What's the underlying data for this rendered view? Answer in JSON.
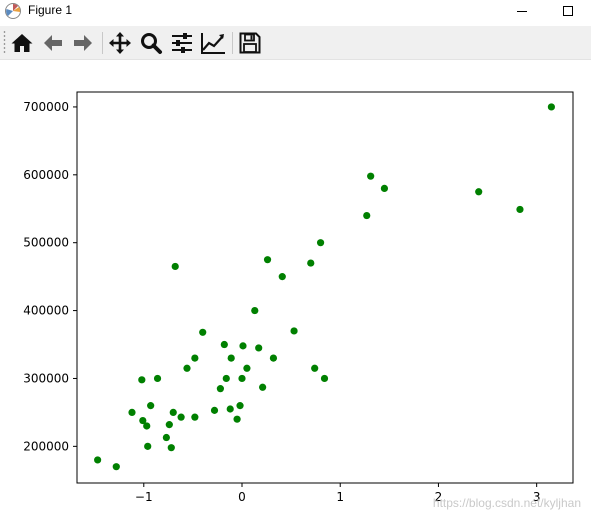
{
  "window": {
    "title": "Figure 1"
  },
  "toolbar": {
    "buttons": [
      "home-icon",
      "back-arrow-icon",
      "forward-arrow-icon",
      "pan-icon",
      "zoom-icon",
      "subplots-config-icon",
      "edit-axis-icon",
      "save-icon"
    ]
  },
  "watermark": "https://blog.csdn.net/kyljhan",
  "chart_data": {
    "type": "scatter",
    "title": "",
    "xlabel": "",
    "ylabel": "",
    "xlim": [
      -1.68,
      3.37
    ],
    "ylim": [
      146000,
      722000
    ],
    "xticks": [
      -1,
      0,
      1,
      2,
      3
    ],
    "xtick_labels": [
      "−1",
      "0",
      "1",
      "2",
      "3"
    ],
    "yticks": [
      200000,
      300000,
      400000,
      500000,
      600000,
      700000
    ],
    "ytick_labels": [
      "200000",
      "300000",
      "400000",
      "500000",
      "600000",
      "700000"
    ],
    "grid": false,
    "legend": "none",
    "color": "#008000",
    "series": [
      {
        "points": [
          [
            -1.47,
            180000
          ],
          [
            -1.28,
            170000
          ],
          [
            -1.12,
            250000
          ],
          [
            -1.02,
            298000
          ],
          [
            -1.01,
            238000
          ],
          [
            -0.97,
            230000
          ],
          [
            -0.96,
            200000
          ],
          [
            -0.93,
            260000
          ],
          [
            -0.86,
            300000
          ],
          [
            -0.77,
            213000
          ],
          [
            -0.74,
            232000
          ],
          [
            -0.72,
            198000
          ],
          [
            -0.7,
            250000
          ],
          [
            -0.68,
            465000
          ],
          [
            -0.62,
            243000
          ],
          [
            -0.56,
            315000
          ],
          [
            -0.48,
            243000
          ],
          [
            -0.48,
            330000
          ],
          [
            -0.4,
            368000
          ],
          [
            -0.28,
            253000
          ],
          [
            -0.22,
            285000
          ],
          [
            -0.18,
            350000
          ],
          [
            -0.16,
            300000
          ],
          [
            -0.12,
            255000
          ],
          [
            -0.11,
            330000
          ],
          [
            -0.05,
            240000
          ],
          [
            -0.02,
            260000
          ],
          [
            0.0,
            300000
          ],
          [
            0.01,
            348000
          ],
          [
            0.05,
            315000
          ],
          [
            0.13,
            400000
          ],
          [
            0.17,
            345000
          ],
          [
            0.21,
            287000
          ],
          [
            0.26,
            475000
          ],
          [
            0.32,
            330000
          ],
          [
            0.41,
            450000
          ],
          [
            0.53,
            370000
          ],
          [
            0.7,
            470000
          ],
          [
            0.74,
            315000
          ],
          [
            0.8,
            500000
          ],
          [
            0.84,
            300000
          ],
          [
            1.27,
            540000
          ],
          [
            1.31,
            598000
          ],
          [
            1.45,
            580000
          ],
          [
            2.41,
            575000
          ],
          [
            2.83,
            549000
          ],
          [
            3.15,
            700000
          ]
        ]
      }
    ]
  }
}
